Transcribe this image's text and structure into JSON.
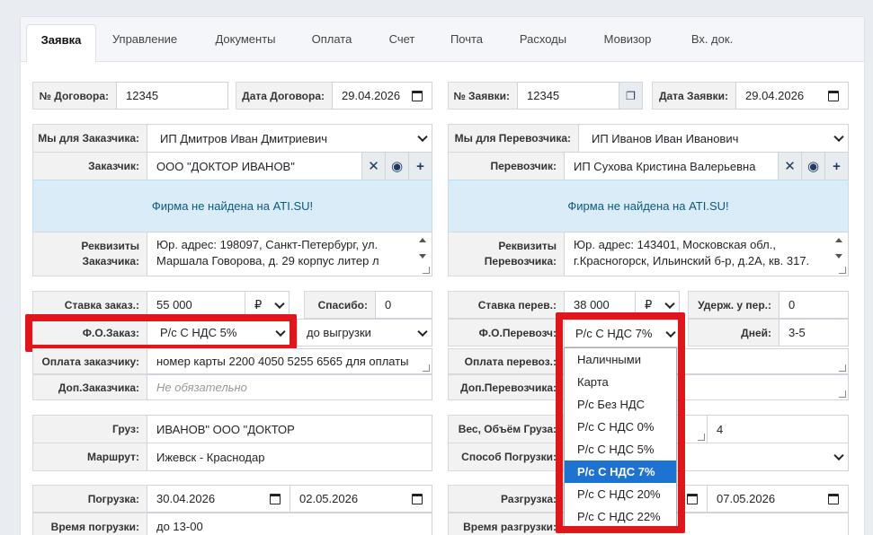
{
  "tabs": [
    "Заявка",
    "Управление",
    "Документы",
    "Оплата",
    "Счет",
    "Почта",
    "Расходы",
    "Мовизор",
    "Вх. док."
  ],
  "left": {
    "contract_no_label": "№ Договора:",
    "contract_no": "12345",
    "contract_date_label": "Дата Договора:",
    "contract_date": "29.04.2026",
    "we_for_customer_label": "Мы для Заказчика:",
    "we_for_customer": "ИП Дмитров Иван Дмитриевич",
    "customer_label": "Заказчик:",
    "customer": "ООО \"ДОКТОР ИВАНОВ\"",
    "notice": "Фирма не найдена на ATI.SU!",
    "requisites_label_1": "Реквизиты",
    "requisites_label_2": "Заказчика:",
    "requisites_line1": "Юр. адрес: 198097, Санкт-Петербург, ул.",
    "requisites_line2": "Маршала Говорова, д. 29 корпус литер л",
    "rate_label": "Ставка заказ.:",
    "rate": "55 000",
    "currency": "₽",
    "thanks_label": "Спасибо:",
    "thanks": "0",
    "payment_form_label": "Ф.О.Заказ:",
    "payment_form": "Р/с С НДС 5%",
    "payment_term": "до выгрузки",
    "customer_payment_label": "Оплата заказчику:",
    "customer_payment": "номер карты 2200 4050 5255 6565 для оплаты",
    "extra_customer_label": "Доп.Заказчика:",
    "extra_customer_placeholder": "Не обязательно",
    "cargo_label": "Груз:",
    "cargo": "ИВАНОВ\" ООО \"ДОКТОР",
    "route_label": "Маршрут:",
    "route": "Ижевск - Краснодар",
    "loading_label": "Погрузка:",
    "loading_from": "30.04.2026",
    "loading_to": "02.05.2026",
    "loading_time_label": "Время погрузки:",
    "loading_time": "до 13-00"
  },
  "right": {
    "order_no_label": "№ Заявки:",
    "order_no": "12345",
    "order_date_label": "Дата Заявки:",
    "order_date": "29.04.2026",
    "we_for_carrier_label": "Мы для Перевозчика:",
    "we_for_carrier": "ИП Иванов Иван Иванович",
    "carrier_label": "Перевозчик:",
    "carrier": "ИП Сухова Кристина Валерьевна",
    "notice": "Фирма не найдена на ATI.SU!",
    "requisites_label_1": "Реквизиты",
    "requisites_label_2": "Перевозчика:",
    "requisites_line1": "Юр. адрес: 143401, Московская обл.,",
    "requisites_line2": "г.Красногорск, Ильинский б-р, д.2А, кв. 317.",
    "rate_label": "Ставка перев.:",
    "rate": "38 000",
    "currency": "₽",
    "withheld_label": "Удерж. у пер.:",
    "withheld": "0",
    "payment_form_label": "Ф.О.Перевозч:",
    "payment_form": "Р/с С НДС 7%",
    "days_label": "Дней:",
    "days": "3-5",
    "carrier_payment_label": "Оплата перевоз.:",
    "extra_carrier_label": "Доп.Перевозчика:",
    "weight_label": "Вес, Объём Груза:",
    "weight_value": "4",
    "loading_method_label": "Способ Погрузки:",
    "unloading_label": "Разгрузка:",
    "unloading_to": "07.05.2026",
    "unloading_time_label": "Время разгрузки:"
  },
  "dropdown": {
    "options": [
      "Наличными",
      "Карта",
      "Р/с Без НДС",
      "Р/с С НДС 0%",
      "Р/с С НДС 5%",
      "Р/с С НДС 7%",
      "Р/с С НДС 20%",
      "Р/с С НДС 22%"
    ],
    "selected": "Р/с С НДС 7%"
  },
  "highlight_color": "#e0161d",
  "accent_color": "#1e73d2"
}
